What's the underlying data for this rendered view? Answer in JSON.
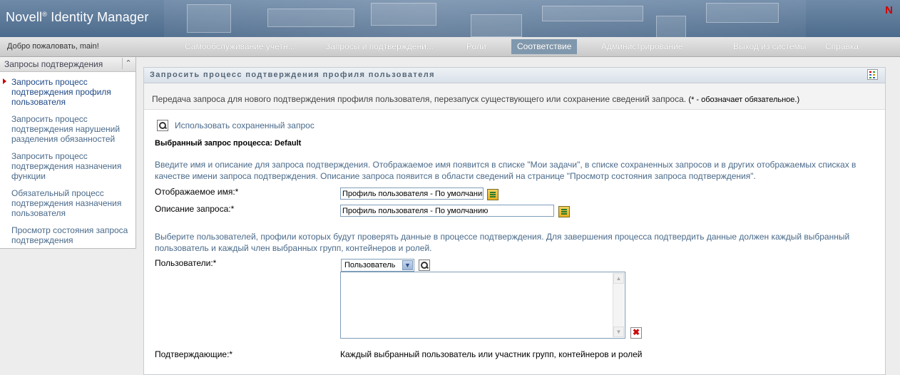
{
  "header": {
    "brand": "Novell",
    "brand_reg": "®",
    "product": " Identity Manager",
    "logo_letter": "N"
  },
  "nav": {
    "welcome": "Добро пожаловать, main!",
    "items": [
      {
        "label": "Самообслуживание учетн..."
      },
      {
        "label": "Запросы и подтверждени..."
      },
      {
        "label": "Роли"
      },
      {
        "label": "Соответствие"
      },
      {
        "label": "Администрирование"
      },
      {
        "label": "Выход из системы"
      },
      {
        "label": "Справка"
      }
    ],
    "active": "Соответствие"
  },
  "sidebar": {
    "title": "Запросы подтверждения",
    "collapse_glyph": "⌃",
    "items": [
      {
        "label": "Запросить процесс подтверждения профиля пользователя"
      },
      {
        "label": "Запросить процесс подтверждения нарушений разделения обязанностей"
      },
      {
        "label": "Запросить процесс подтверждения назначения функции"
      },
      {
        "label": "Обязательный процесс подтверждения назначения пользователя"
      },
      {
        "label": "Просмотр состояния запроса подтверждения"
      }
    ]
  },
  "panel": {
    "title": "Запросить процесс подтверждения профиля пользователя",
    "description": "Передача запроса для нового подтверждения профиля пользователя, перезапуск существующего или сохранение сведений запроса. ",
    "required_note": "(* - обозначает обязательное.)",
    "use_saved_link": "Использовать сохраненный запрос",
    "selected_request": "Выбранный запрос процесса: Default",
    "intro_text": "Введите имя и описание для запроса подтверждения. Отображаемое имя появится в списке \"Мои задачи\", в списке сохраненных запросов и в других отображаемых списках в качестве имени запроса подтверждения. Описание запроса появится в области сведений на странице \"Просмотр состояния запроса подтверждения\".",
    "display_name_label": "Отображаемое имя:*",
    "display_name_value": "Профиль пользователя - По умолчанию",
    "request_desc_label": "Описание запроса:*",
    "request_desc_value": "Профиль пользователя - По умолчанию",
    "users_intro": "Выберите пользователей, профили которых будут проверять данные в процессе подтверждения. Для завершения процесса подтвердить данные должен каждый выбранный пользователь и каждый член выбранных групп, контейнеров и ролей.",
    "users_label": "Пользователи:*",
    "users_select": "Пользователь",
    "attesters_label": "Подтверждающие:*",
    "attesters_value": "Каждый выбранный пользователь или участник групп, контейнеров и ролей"
  }
}
